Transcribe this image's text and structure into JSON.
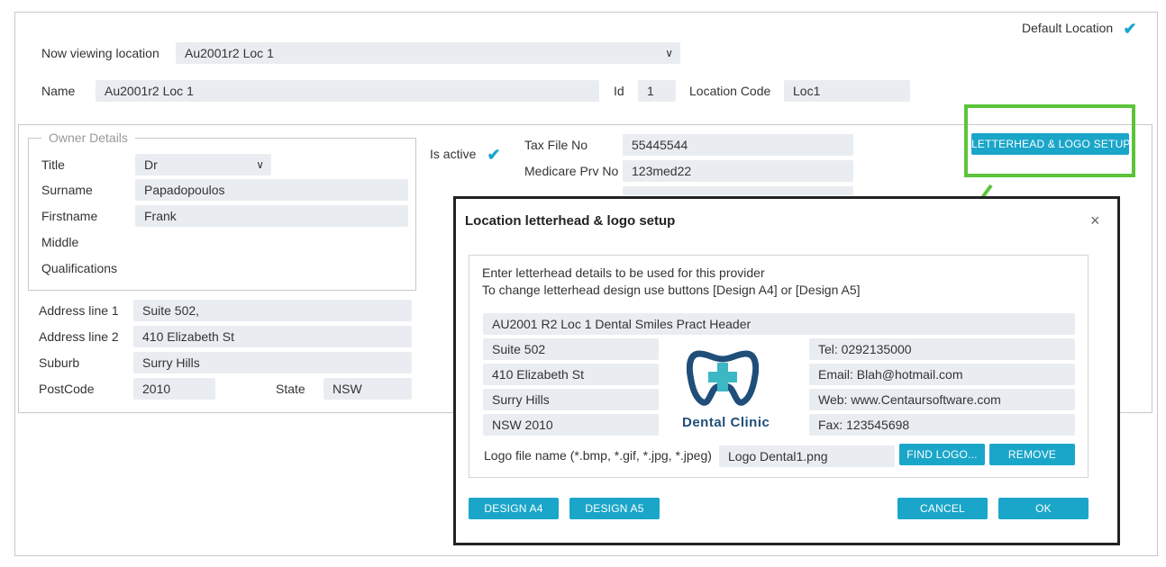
{
  "default_location": {
    "label": "Default Location",
    "checked": true
  },
  "now_viewing": {
    "label": "Now viewing location",
    "value": "Au2001r2 Loc 1"
  },
  "name": {
    "label": "Name",
    "value": "Au2001r2 Loc 1"
  },
  "id": {
    "label": "Id",
    "value": "1"
  },
  "location_code": {
    "label": "Location Code",
    "value": "Loc1"
  },
  "owner": {
    "legend": "Owner Details",
    "title_label": "Title",
    "title_value": "Dr",
    "surname_label": "Surname",
    "surname_value": "Papadopoulos",
    "firstname_label": "Firstname",
    "firstname_value": "Frank",
    "middle_label": "Middle",
    "middle_value": "",
    "qualifications_label": "Qualifications",
    "qualifications_value": ""
  },
  "address": {
    "line1_label": "Address line 1",
    "line1_value": "Suite 502,",
    "line2_label": "Address line 2",
    "line2_value": "410 Elizabeth St",
    "suburb_label": "Suburb",
    "suburb_value": "Surry Hills",
    "postcode_label": "PostCode",
    "postcode_value": "2010",
    "state_label": "State",
    "state_value": "NSW"
  },
  "is_active": {
    "label": "Is active",
    "checked": true
  },
  "tax_file": {
    "label": "Tax File No",
    "value": "55445544"
  },
  "medicare": {
    "label": "Medicare Prv No",
    "value": "123med22"
  },
  "letterhead_button": "LETTERHEAD & LOGO SETUP",
  "modal": {
    "title": "Location letterhead & logo setup",
    "close": "×",
    "intro1": "Enter letterhead details to be used for this provider",
    "intro2": "To change letterhead design use buttons [Design A4] or [Design A5]",
    "header": "AU2001 R2 Loc 1 Dental Smiles Pract Header",
    "left": [
      "Suite 502",
      "410 Elizabeth St",
      "Surry Hills",
      "NSW 2010"
    ],
    "right": [
      "Tel: 0292135000",
      "Email: Blah@hotmail.com",
      "Web: www.Centaursoftware.com",
      "Fax: 123545698"
    ],
    "logo_text": "Dental Clinic",
    "logo_file_label": "Logo file name (*.bmp, *.gif, *.jpg, *.jpeg)",
    "logo_file_value": "Logo Dental1.png",
    "find_logo": "FIND LOGO...",
    "remove": "REMOVE",
    "design_a4": "DESIGN A4",
    "design_a5": "DESIGN A5",
    "cancel": "CANCEL",
    "ok": "OK"
  },
  "colors": {
    "accent": "#1aa6c9",
    "highlight": "#5cc43a",
    "logo_dark": "#1f4e79"
  }
}
